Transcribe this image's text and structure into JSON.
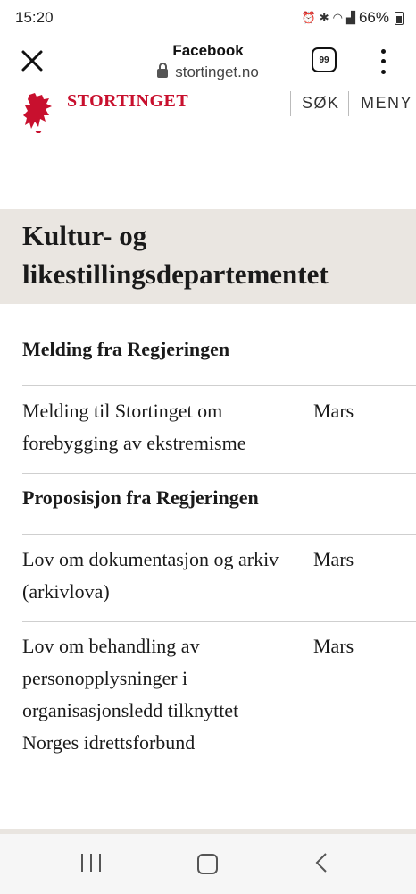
{
  "status_bar": {
    "time": "15:20",
    "battery": "66%",
    "icons": [
      "alarm-icon",
      "bluetooth-icon",
      "wifi-icon",
      "signal-icon",
      "battery-icon"
    ]
  },
  "browser": {
    "title": "Facebook",
    "url": "stortinget.no",
    "tab_count": "99"
  },
  "site": {
    "logo_text": "STORTINGET",
    "search_label": "SØK",
    "menu_label": "MENY",
    "brand_color": "#c8102e"
  },
  "department": {
    "title": "Kultur- og likestillingsdepartementet"
  },
  "sections": [
    {
      "heading": "Melding fra Regjeringen",
      "items": [
        {
          "title": "Melding til Stortinget om forebygging av ekstremisme",
          "month": "Mars"
        }
      ]
    },
    {
      "heading": "Proposisjon fra Regjeringen",
      "items": [
        {
          "title": "Lov om dokumentasjon og arkiv (arkivlova)",
          "month": "Mars"
        },
        {
          "title": "Lov om behandling av personopplysninger i organisasjonsledd tilknyttet Norges idrettsforbund",
          "month": "Mars"
        }
      ]
    }
  ]
}
